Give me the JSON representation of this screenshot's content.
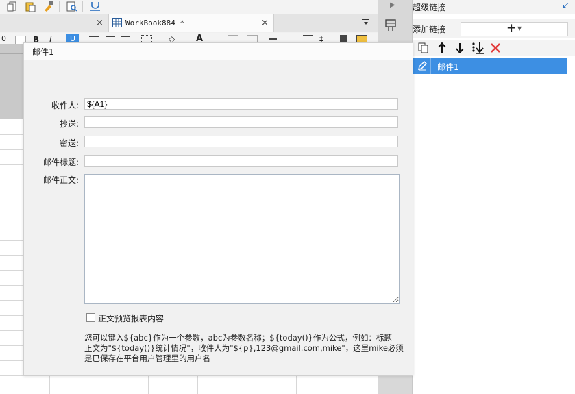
{
  "tab": {
    "title": "WorkBook884 *",
    "close_glyph": "×"
  },
  "format_bar": {
    "zoom_fragment": "0"
  },
  "right_panel": {
    "title": "超级链接",
    "add_label": "添加链接",
    "add_glyph": "+",
    "links": [
      {
        "label": "邮件1"
      }
    ]
  },
  "dialog": {
    "title": "邮件1",
    "fields": {
      "recipient": {
        "label": "收件人:",
        "value": "${A1}"
      },
      "cc": {
        "label": "抄送:",
        "value": ""
      },
      "bcc": {
        "label": "密送:",
        "value": ""
      },
      "subject": {
        "label": "邮件标题:",
        "value": ""
      },
      "body": {
        "label": "邮件正文:",
        "value": ""
      }
    },
    "preview_checkbox": {
      "label": "正文预览报表内容",
      "checked": false
    },
    "note_lines": [
      "您可以键入${abc}作为一个参数，abc为参数名称；${today()}作为公式，例如：标题",
      "正文为\"${today()}统计情况\"，收件人为\"${p},123@gmail.com,mike\"，这里mike必须",
      "是已保存在平台用户管理里的用户名"
    ]
  },
  "colors": {
    "accent": "#3d8fe3",
    "delete": "#e23b3b"
  }
}
